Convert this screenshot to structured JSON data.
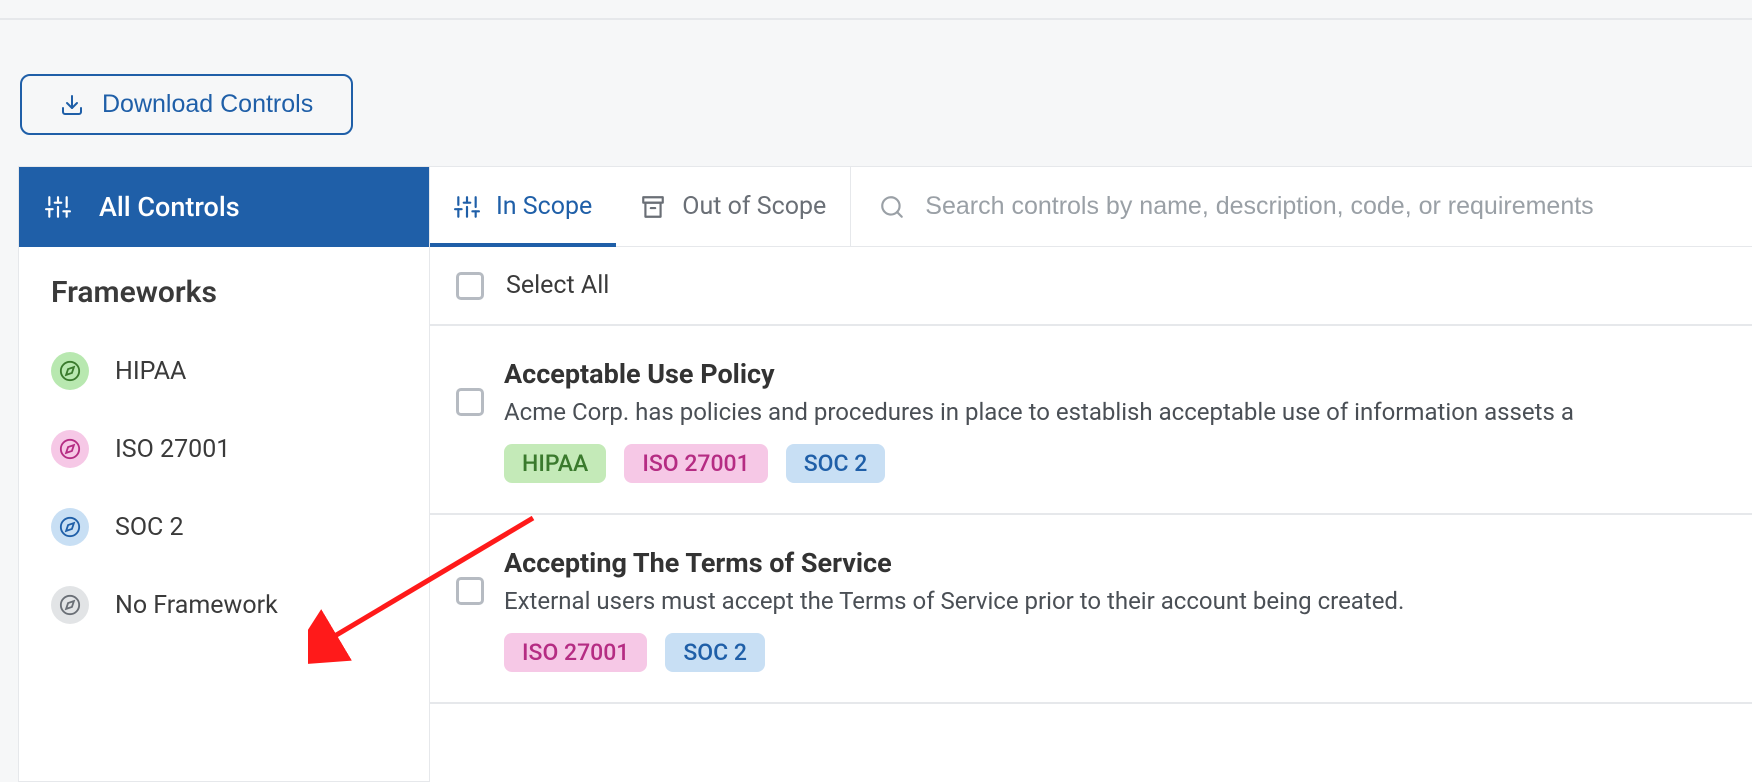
{
  "download_label": "Download Controls",
  "sidebar": {
    "all_controls_label": "All Controls",
    "frameworks_header": "Frameworks",
    "items": [
      {
        "label": "HIPAA",
        "colorClass": "fw-green",
        "compass": "#3a7a2d"
      },
      {
        "label": "ISO 27001",
        "colorClass": "fw-pink",
        "compass": "#b52c83"
      },
      {
        "label": "SOC 2",
        "colorClass": "fw-blue",
        "compass": "#1f5fa8"
      },
      {
        "label": "No Framework",
        "colorClass": "fw-grey",
        "compass": "#6a6f76"
      }
    ]
  },
  "tabs": {
    "in_scope": "In Scope",
    "out_of_scope": "Out of Scope"
  },
  "search": {
    "placeholder": "Search controls by name, description, code, or requirements"
  },
  "select_all_label": "Select All",
  "controls": [
    {
      "title": "Acceptable Use Policy",
      "desc": "Acme Corp. has policies and procedures in place to establish acceptable use of information assets a",
      "tags": [
        {
          "label": "HIPAA",
          "cls": "tag-hipaa"
        },
        {
          "label": "ISO 27001",
          "cls": "tag-iso"
        },
        {
          "label": "SOC 2",
          "cls": "tag-soc2"
        }
      ]
    },
    {
      "title": "Accepting The Terms of Service",
      "desc": "External users must accept the Terms of Service prior to their account being created.",
      "tags": [
        {
          "label": "ISO 27001",
          "cls": "tag-iso"
        },
        {
          "label": "SOC 2",
          "cls": "tag-soc2"
        }
      ]
    }
  ]
}
